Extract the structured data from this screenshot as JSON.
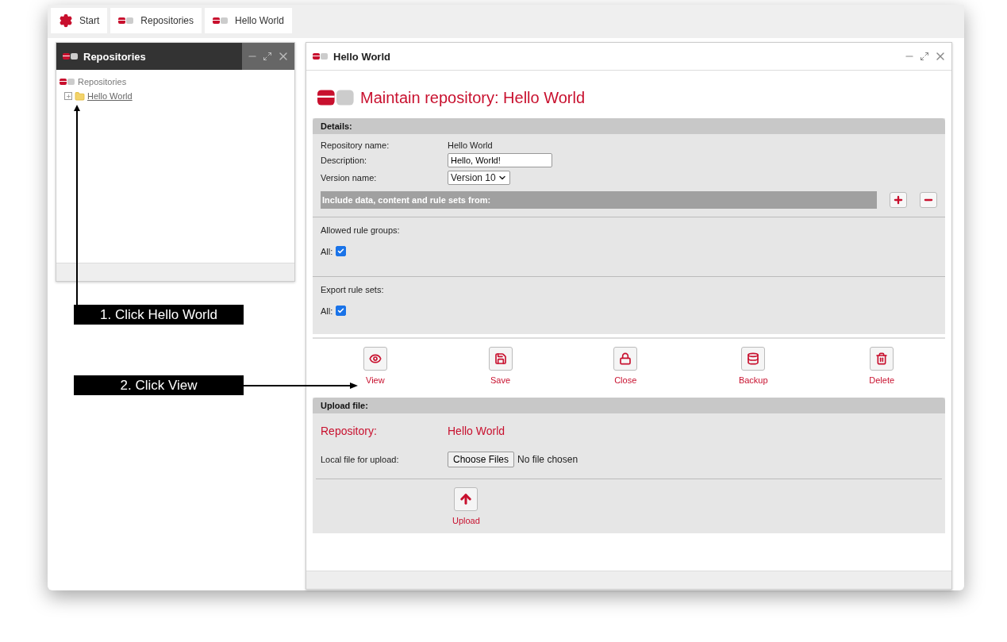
{
  "tabs": [
    {
      "label": "Start"
    },
    {
      "label": "Repositories"
    },
    {
      "label": "Hello World"
    }
  ],
  "left_panel": {
    "title": "Repositories",
    "tree": {
      "label": "Repositories",
      "children": [
        {
          "label": "Hello World",
          "expanded": false
        }
      ]
    }
  },
  "main_panel": {
    "title": "Hello World",
    "heading": "Maintain repository: Hello World",
    "details": {
      "title": "Details:",
      "repository_name_label": "Repository name:",
      "repository_name": "Hello World",
      "description_label": "Description:",
      "description": "Hello, World!",
      "version_label": "Version name:",
      "version": "Version 10",
      "include_bar": "Include data, content and rule sets from:",
      "groups": [
        {
          "label": "Allowed rule groups:",
          "all_label": "All:",
          "checked": true
        },
        {
          "label": "Export rule sets:",
          "all_label": "All:",
          "checked": true
        }
      ]
    },
    "actions": [
      {
        "label": "View"
      },
      {
        "label": "Save"
      },
      {
        "label": "Close"
      },
      {
        "label": "Backup"
      },
      {
        "label": "Delete"
      }
    ],
    "upload": {
      "title": "Upload file:",
      "repository_label": "Repository:",
      "repository": "Hello World",
      "file_label": "Local file for upload:",
      "choose_button": "Choose Files",
      "file_status": "No file chosen",
      "upload_button": "Upload"
    }
  },
  "callouts": [
    "1. Click Hello World",
    "2. Click View"
  ]
}
